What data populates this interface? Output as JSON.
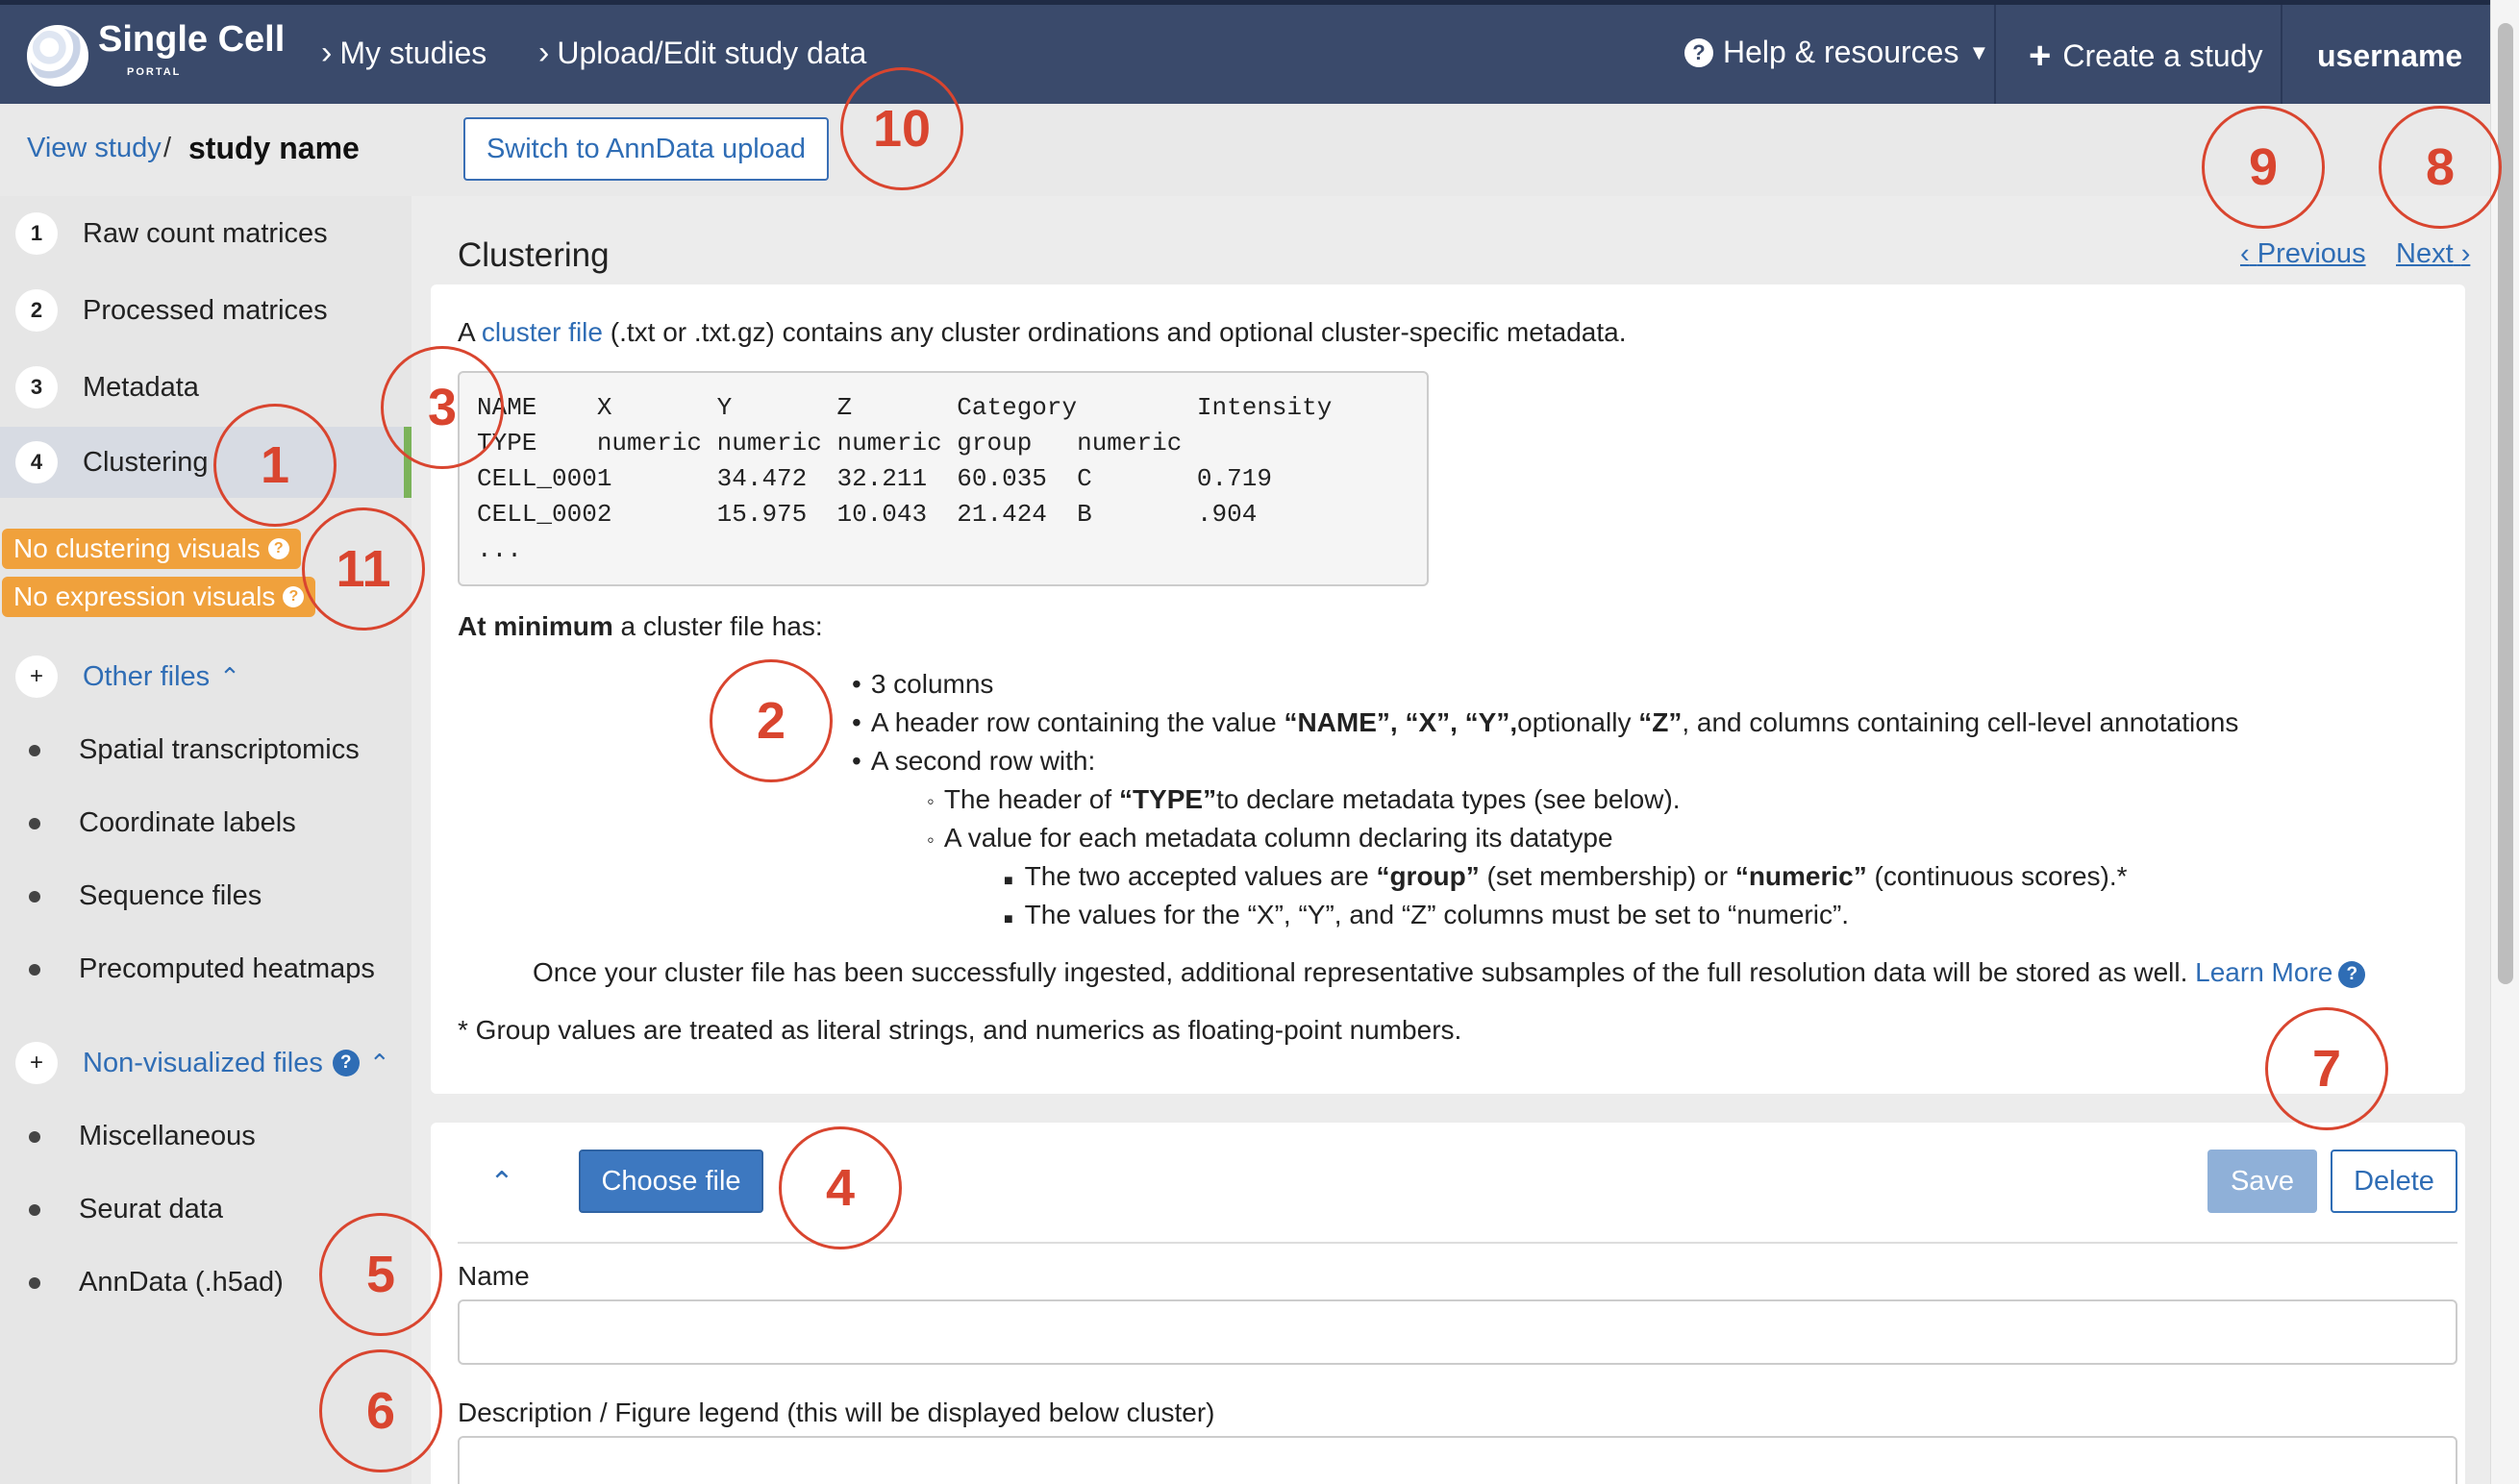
{
  "navbar": {
    "logo_title": "Single Cell",
    "logo_sub": "PORTAL",
    "my_studies": "My studies",
    "upload_edit": "Upload/Edit study data",
    "help": "Help & resources",
    "create_study": "Create a study",
    "username": "username"
  },
  "breadcrumb": {
    "view_study": "View study",
    "slash": "/",
    "study_name": "study name"
  },
  "switch_button": "Switch to AnnData upload",
  "sidebar": {
    "steps": [
      {
        "num": "1",
        "label": "Raw count matrices"
      },
      {
        "num": "2",
        "label": "Processed matrices"
      },
      {
        "num": "3",
        "label": "Metadata"
      },
      {
        "num": "4",
        "label": "Clustering"
      }
    ],
    "badges": [
      "No clustering visuals",
      "No expression visuals"
    ],
    "other_files": {
      "label": "Other files",
      "items": [
        "Spatial transcriptomics",
        "Coordinate labels",
        "Sequence files",
        "Precomputed heatmaps"
      ]
    },
    "non_visualized": {
      "label": "Non-visualized files",
      "items": [
        "Miscellaneous",
        "Seurat data",
        "AnnData (.h5ad)"
      ]
    }
  },
  "main": {
    "title": "Clustering",
    "previous": "Previous",
    "next": "Next",
    "intro_pre": "A ",
    "intro_link": "cluster file",
    "intro_post": " (.txt or .txt.gz) contains any cluster ordinations and optional cluster-specific metadata.",
    "code_sample": "NAME    X       Y       Z       Category        Intensity\nTYPE    numeric numeric numeric group   numeric\nCELL_0001       34.472  32.211  60.035  C       0.719\nCELL_0002       15.975  10.043  21.424  B       .904\n...",
    "at_min_bold": "At minimum",
    "at_min_rest": " a cluster file has:",
    "bullets": {
      "b1": "3 columns",
      "b2_pre": "A header row containing the value ",
      "b2_bold1": "“NAME”, “X”, “Y”,",
      "b2_mid": "optionally ",
      "b2_bold2": "“Z”",
      "b2_post": ", and columns containing cell-level annotations",
      "b3": "A second row with:",
      "b3a_pre": "The header of ",
      "b3a_bold": "“TYPE”",
      "b3a_post": "to declare metadata types (see below).",
      "b3b": "A value for each metadata column declaring its datatype",
      "b3b1_pre": "The two accepted values are ",
      "b3b1_bold1": "“group”",
      "b3b1_mid": " (set membership) or ",
      "b3b1_bold2": "“numeric”",
      "b3b1_post": " (continuous scores).*",
      "b3b2": "The values for the “X”, “Y”, and “Z” columns must be set to “numeric”."
    },
    "ingest_note": "Once your cluster file has been successfully ingested, additional representative subsamples of the full resolution data will be stored as well.",
    "learn_more": "Learn More",
    "footnote": "* Group values are treated as literal strings, and numerics as floating-point numbers."
  },
  "form": {
    "choose_file": "Choose file",
    "save": "Save",
    "delete": "Delete",
    "name_label": "Name",
    "name_value": "",
    "desc_label": "Description / Figure legend (this will be displayed below cluster)",
    "desc_value": ""
  },
  "annotations": [
    "1",
    "2",
    "3",
    "4",
    "5",
    "6",
    "7",
    "8",
    "9",
    "10",
    "11"
  ],
  "colors": {
    "navbar": "#3a4a6b",
    "link": "#2f6db5",
    "badge": "#f0a13c",
    "active_marker": "#7bb35a",
    "annotation": "#d9452f"
  }
}
